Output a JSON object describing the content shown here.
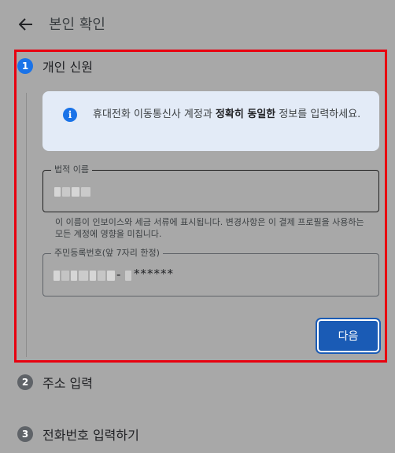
{
  "header": {
    "back_icon": "arrow-left-icon",
    "title": "본인 확인"
  },
  "steps": [
    {
      "number": "1",
      "label": "개인 신원",
      "state": "active"
    },
    {
      "number": "2",
      "label": "주소 입력",
      "state": "pending"
    },
    {
      "number": "3",
      "label": "전화번호 입력하기",
      "state": "pending"
    }
  ],
  "info": {
    "icon": "info-icon",
    "text_before": "휴대전화 이동통신사 계정과 ",
    "text_bold": "정확히 동일한",
    "text_after": " 정보를 입력하세요."
  },
  "name_field": {
    "label": "법적 이름",
    "helper": "이 이름이 인보이스와 세금 서류에 표시됩니다. 변경사항은 이 결제 프로필을 사용하는 모든 계정에 영향을 미칩니다."
  },
  "id_field": {
    "label": "주민등록번호(앞 7자리 한정)",
    "separator": "-",
    "masked": "******"
  },
  "next_button": "다음",
  "colors": {
    "highlight_border": "#e8000f",
    "accent": "#1a73e8",
    "button": "#1a5bb5"
  }
}
